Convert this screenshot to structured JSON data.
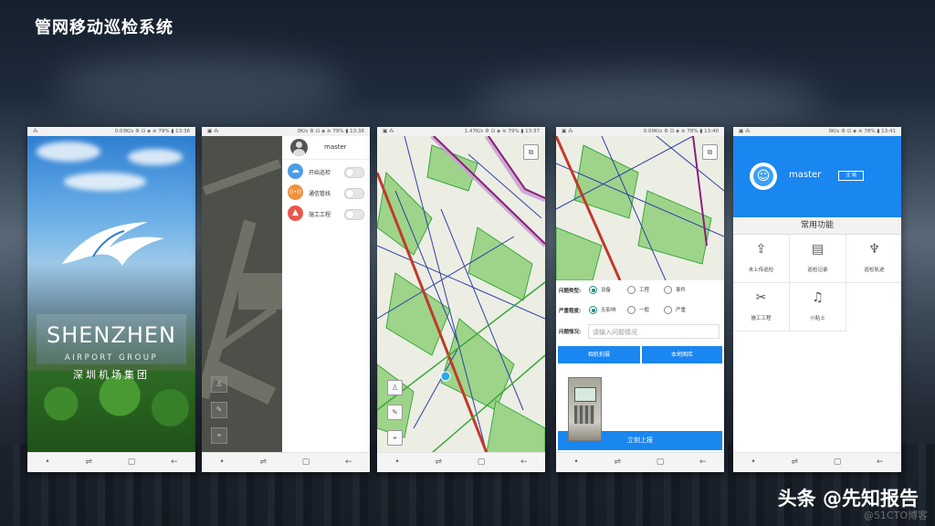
{
  "slide": {
    "title": "管网移动巡检系统"
  },
  "phones": [
    {
      "status_left": "⁂",
      "status_right": "0.03K/s ⚙ ⊡ ◈ ≋ 79% ▮ 13:36"
    },
    {
      "status_left": "▣ ⁂",
      "status_right": "0K/s ⚙ ⊡ ◈ ≋ 79% ▮ 13:36"
    },
    {
      "status_left": "▣ ⁂",
      "status_right": "1.47K/s ⚙ ⊡ ◈ ≋ 79% ▮ 13:37"
    },
    {
      "status_left": "▣ ⁂",
      "status_right": "0.09K/s ⚙ ⊡ ◈ ≋ 78% ▮ 13:40"
    },
    {
      "status_left": "▣ ⁂",
      "status_right": "0K/s ⚙ ⊡ ◈ ≋ 78% ▮ 13:41"
    }
  ],
  "nav": {
    "dot": "•",
    "recent": "⇌",
    "home": "▢",
    "back": "←"
  },
  "splash": {
    "title": "SHENZHEN",
    "subtitle": "AIRPORT GROUP",
    "chinese": "深圳机场集团"
  },
  "drawer": {
    "username": "master",
    "items": [
      {
        "label": "开始巡检",
        "icon": "cloud-icon",
        "glyph": "☁",
        "color": "#4a9de8"
      },
      {
        "label": "通信管线",
        "icon": "signal-icon",
        "glyph": "((•))",
        "color": "#f0913b"
      },
      {
        "label": "施工工程",
        "icon": "cone-icon",
        "glyph": "▲",
        "color": "#e8574a"
      }
    ]
  },
  "map_icons": {
    "layers": "⧉",
    "locate": "⌖",
    "user": "♙",
    "edit": "✎"
  },
  "report_form": {
    "type_label": "问题类型:",
    "type_options": [
      "设备",
      "工程",
      "事件"
    ],
    "type_selected": "设备",
    "severity_label": "严重程度:",
    "severity_options": [
      "无影响",
      "一般",
      "严重"
    ],
    "severity_selected": "无影响",
    "desc_label": "问题情况:",
    "desc_placeholder": "请输入问题情况",
    "camera_button": "相机拍摄",
    "gallery_button": "本地图库",
    "submit_button": "立刻上报"
  },
  "home": {
    "username": "master",
    "logout": "注 销",
    "section_title": "常用功能",
    "tiles": [
      {
        "label": "未上传巡检",
        "icon": "upload-icon",
        "glyph": "⇪"
      },
      {
        "label": "巡检记录",
        "icon": "clipboard-icon",
        "glyph": "▤"
      },
      {
        "label": "巡检轨迹",
        "icon": "footprint-icon",
        "glyph": "♆"
      },
      {
        "label": "施工工程",
        "icon": "tools-icon",
        "glyph": "✂"
      },
      {
        "label": "小贴士",
        "icon": "bell-icon",
        "glyph": "♫"
      }
    ]
  },
  "watermark": {
    "main": "头条 @先知报告",
    "sub": "@51CTO博客"
  }
}
